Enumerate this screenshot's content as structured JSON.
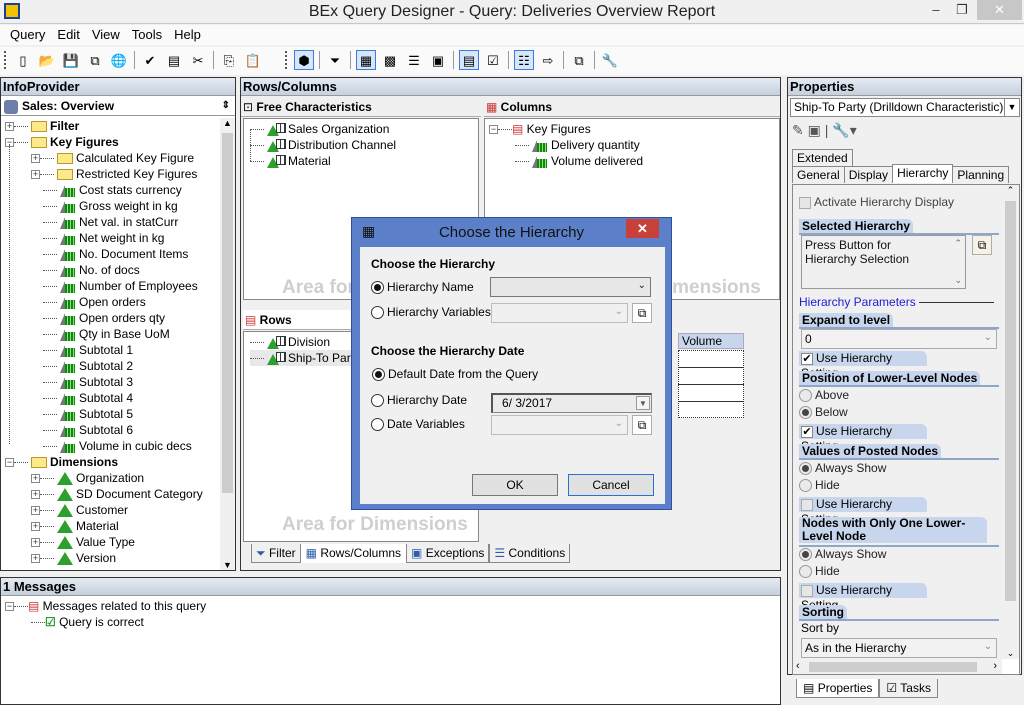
{
  "window": {
    "title": "BEx Query Designer - Query: Deliveries Overview Report",
    "minimize": "–",
    "restore": "❐",
    "close": "✕"
  },
  "menu": [
    "Query",
    "Edit",
    "View",
    "Tools",
    "Help"
  ],
  "toolbar": {
    "group1": [
      {
        "name": "new-query-icon",
        "glyph": "▯"
      },
      {
        "name": "open-query-icon",
        "glyph": "📂"
      },
      {
        "name": "save-icon",
        "glyph": "💾"
      },
      {
        "name": "save-all-icon",
        "glyph": "⧉"
      },
      {
        "name": "publish-icon",
        "glyph": "🌐"
      },
      {
        "name": "check-query-icon",
        "glyph": "✔"
      },
      {
        "name": "query-properties-icon",
        "glyph": "▤"
      },
      {
        "name": "cut-icon",
        "glyph": "✂"
      },
      {
        "name": "copy-icon",
        "glyph": "⎘"
      },
      {
        "name": "paste-icon",
        "glyph": "📋"
      }
    ],
    "group2": [
      {
        "name": "infoprovider-icon",
        "glyph": "⬢",
        "active": true
      },
      {
        "name": "filter-icon",
        "glyph": "⏷"
      },
      {
        "name": "rows-columns-icon",
        "glyph": "▦",
        "active": true
      },
      {
        "name": "cells-icon",
        "glyph": "▩"
      },
      {
        "name": "conditions-icon",
        "glyph": "☰"
      },
      {
        "name": "exceptions-icon",
        "glyph": "▣"
      },
      {
        "name": "properties-icon",
        "glyph": "▤",
        "active": true
      },
      {
        "name": "tasks-icon",
        "glyph": "☑"
      },
      {
        "name": "messages-icon",
        "glyph": "☷",
        "active": true
      },
      {
        "name": "where-used-icon",
        "glyph": "⇨"
      },
      {
        "name": "technical-names-icon",
        "glyph": "⧉"
      },
      {
        "name": "tools-icon",
        "glyph": "🔧"
      }
    ]
  },
  "infoprovider": {
    "header": "InfoProvider",
    "selector": "Sales: Overview",
    "tree": {
      "filter": "Filter",
      "key_figures": "Key Figures",
      "kf_folders": [
        "Calculated Key Figure",
        "Restricted Key Figures"
      ],
      "kf_items": [
        "Cost stats currency",
        "Gross weight in kg",
        "Net val. in statCurr",
        "Net weight in kg",
        "No. Document Items",
        "No. of docs",
        "Number of Employees",
        "Open orders",
        "Open orders qty",
        "Qty in Base UoM",
        "Subtotal 1",
        "Subtotal 2",
        "Subtotal 3",
        "Subtotal 4",
        "Subtotal 5",
        "Subtotal 6",
        "Volume in cubic decs"
      ],
      "dimensions": "Dimensions",
      "dim_items": [
        "Organization",
        "SD Document Category",
        "Customer",
        "Material",
        "Value Type",
        "Version"
      ]
    }
  },
  "rows_columns": {
    "header": "Rows/Columns",
    "free_chars": {
      "title": "Free Characteristics",
      "items": [
        "Sales Organization",
        "Distribution Channel",
        "Material"
      ],
      "watermark": "Area for Dimensions"
    },
    "columns": {
      "title": "Columns",
      "root": "Key Figures",
      "items": [
        "Delivery quantity",
        "Volume delivered"
      ],
      "watermark": "Area for Dimensions"
    },
    "rows": {
      "title": "Rows",
      "items": [
        "Division",
        "Ship-To Party"
      ],
      "watermark": "Area for Dimensions"
    },
    "preview": {
      "column_header": "Volume deli"
    },
    "tabs": [
      "Filter",
      "Rows/Columns",
      "Exceptions",
      "Conditions"
    ],
    "selected_tab": "Rows/Columns"
  },
  "messages": {
    "header": "1 Messages",
    "root": "Messages related to this query",
    "items": [
      "Query is correct"
    ]
  },
  "dialog": {
    "title": "Choose the Hierarchy",
    "close": "✕",
    "section1": "Choose the Hierarchy",
    "hierarchy_name_label": "Hierarchy Name",
    "hierarchy_name_value": "",
    "hierarchy_variables_label": "Hierarchy Variables",
    "hierarchy_variables_value": "",
    "section2": "Choose the Hierarchy Date",
    "default_date_label": "Default Date from the Query",
    "hierarchy_date_label": "Hierarchy Date",
    "hierarchy_date_value": "6/ 3/2017",
    "date_variables_label": "Date Variables",
    "date_variables_value": "",
    "selected_hierarchy_option": "Hierarchy Name",
    "selected_date_option": "Default Date from the Query",
    "ok": "OK",
    "cancel": "Cancel"
  },
  "properties": {
    "header": "Properties",
    "selector": "Ship-To Party (Drilldown Characteristic)",
    "tabs_row1": [
      "Extended"
    ],
    "tabs_row2": [
      "General",
      "Display",
      "Hierarchy",
      "Planning"
    ],
    "selected_tab": "Hierarchy",
    "activate_label": "Activate Hierarchy Display",
    "activate_checked": false,
    "selected_hierarchy_title": "Selected Hierarchy",
    "selected_hierarchy_text": "Press Button for Hierarchy Selection",
    "params_title": "Hierarchy Parameters",
    "expand_title": "Expand to level",
    "expand_value": "0",
    "use_setting_label": "Use Hierarchy Setting",
    "expand_use_setting": true,
    "position_title": "Position of Lower-Level Nodes",
    "position_options": [
      "Above",
      "Below"
    ],
    "position_selected": "Below",
    "position_use_setting": true,
    "posted_title": "Values of Posted Nodes",
    "posted_options": [
      "Always Show",
      "Hide"
    ],
    "posted_selected": "Always Show",
    "posted_use_setting": false,
    "one_lower_title": "Nodes with Only One Lower-Level Node",
    "one_lower_options": [
      "Always Show",
      "Hide"
    ],
    "one_lower_selected": "Always Show",
    "one_lower_use_setting": false,
    "sorting_title": "Sorting",
    "sort_by_label": "Sort by",
    "sort_by_value": "As in the Hierarchy",
    "bottom_tabs": [
      "Properties",
      "Tasks"
    ],
    "bottom_selected": "Properties"
  }
}
